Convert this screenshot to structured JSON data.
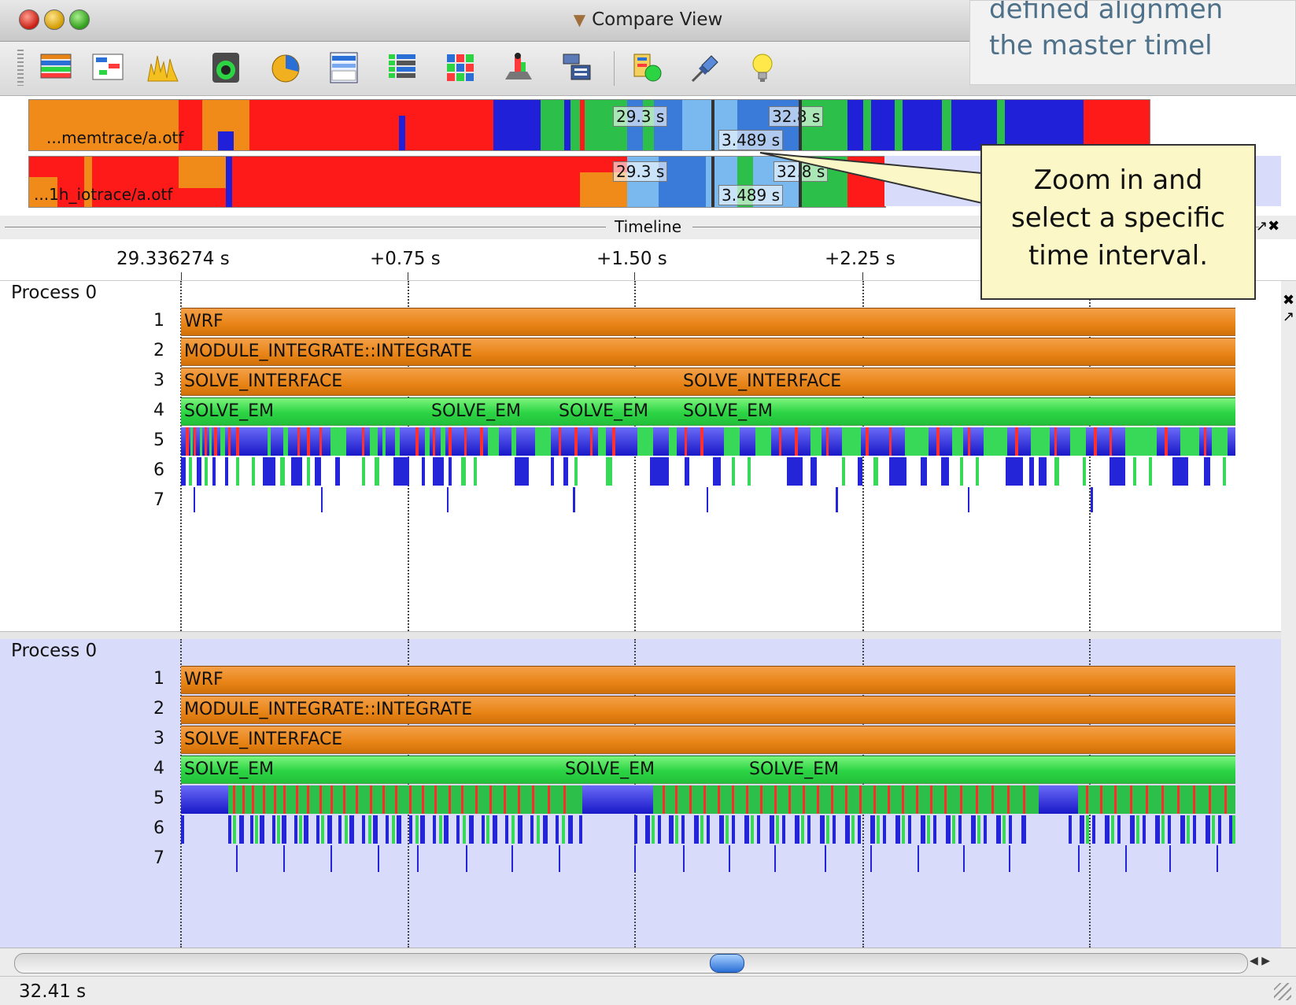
{
  "window": {
    "title": "Compare View"
  },
  "callout_top": {
    "line1": "defined alignmen",
    "line2": "the master timel"
  },
  "callout": {
    "line1": "Zoom in and",
    "line2": "select a specific",
    "line3": "time interval."
  },
  "overview": {
    "trace1": {
      "label": "...memtrace/a.otf",
      "start_time": "29.3 s",
      "end_time": "32.8 s",
      "interval": "3.489 s"
    },
    "trace2": {
      "label": "...1h_iotrace/a.otf",
      "start_time": "29.3 s",
      "end_time": "32.8 s",
      "interval": "3.489 s"
    }
  },
  "timeline": {
    "title": "Timeline",
    "ruler": [
      "29.336274 s",
      "+0.75 s",
      "+1.50 s",
      "+2.25 s"
    ]
  },
  "panel1": {
    "process": "Process 0",
    "levels": [
      "1",
      "2",
      "3",
      "4",
      "5",
      "6",
      "7"
    ],
    "functions": {
      "l1": "WRF",
      "l2": "MODULE_INTEGRATE::INTEGRATE",
      "l3a": "SOLVE_INTERFACE",
      "l3b": "SOLVE_INTERFACE",
      "l4a": "SOLVE_EM",
      "l4b": "SOLVE_EM",
      "l4c": "SOLVE_EM",
      "l4d": "SOLVE_EM"
    }
  },
  "panel2": {
    "process": "Process 0",
    "levels": [
      "1",
      "2",
      "3",
      "4",
      "5",
      "6",
      "7"
    ],
    "functions": {
      "l1": "WRF",
      "l2": "MODULE_INTEGRATE::INTEGRATE",
      "l3": "SOLVE_INTERFACE",
      "l4a": "SOLVE_EM",
      "l4b": "SOLVE_EM",
      "l4c": "SOLVE_EM"
    }
  },
  "status": {
    "time": "32.41 s"
  },
  "colors": {
    "function_orange": "#e88416",
    "solve_green": "#2cd444",
    "mpi_red": "#ff1a1a",
    "io_blue": "#2020d8",
    "panel2_bg": "#d8dbfa",
    "callout_bg": "#fbf7c6",
    "callout_top_text": "#4e7088"
  },
  "toolbar_icons": [
    "master-timeline-icon",
    "process-timeline-icon",
    "counter-timeline-icon",
    "function-summary-icon",
    "process-summary-icon",
    "message-summary-icon",
    "communication-matrix-icon",
    "io-events-icon",
    "call-tree-icon",
    "call-graph-icon",
    "filter-icon",
    "marker-icon",
    "pin-icon",
    "lightbulb-icon"
  ]
}
